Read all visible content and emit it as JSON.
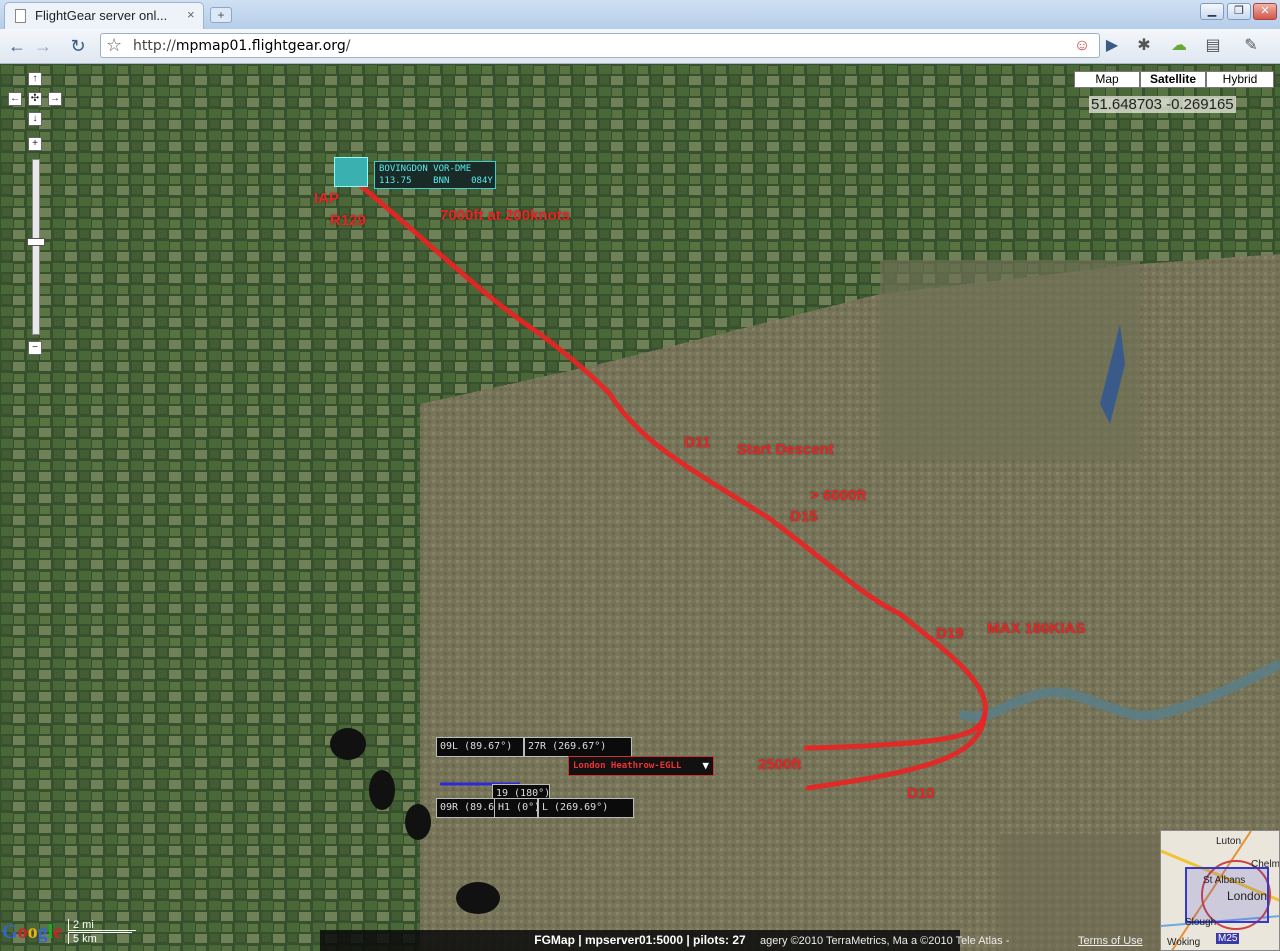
{
  "browser": {
    "tab_title": "FlightGear server onl...",
    "tab_close": "×",
    "new_tab": "+",
    "window_controls": {
      "minimize": "▁",
      "restore": "❐",
      "close": "✕"
    },
    "nav": {
      "back": "←",
      "forward": "→",
      "reload": "↻"
    },
    "url_prefix": "http://",
    "url_host": "mpmap01.flightgear.org",
    "url_path": "/"
  },
  "map": {
    "type_buttons": [
      "Map",
      "Satellite",
      "Hybrid"
    ],
    "selected_type": "Satellite",
    "coordinates": "51.648703 -0.269165",
    "controls": {
      "up": "↑",
      "down": "↓",
      "left": "←",
      "right": "→",
      "center": "✣",
      "zoom_in": "+",
      "zoom_out": "−"
    },
    "navaid": {
      "name_line": "BOVINGDON VOR-DME",
      "freq_line": "113.75    BNN    084Y"
    },
    "annotations": {
      "iap": "IAP",
      "r129": "R129",
      "alt_speed": "7000ft at 200knots",
      "d11": "D11",
      "start_descent": "Start Descent",
      "gt6000": ">  6000ft",
      "d15": "D15",
      "d19": "D19",
      "max180": "MAX 180KIAS",
      "alt2500": "2500ft",
      "d10": "D10"
    },
    "runways": {
      "r09l": "09L (89.67°)",
      "r27r": "27R (269.67°)",
      "r09r": "09R (89.6",
      "r27l": "L (269.69°)",
      "r19": "19 (180°)",
      "h1": "H1 (0°)"
    },
    "airport": "London Heathrow-EGLL",
    "airport_dropdown": "▼",
    "status": "FGMap | mpserver01:5000 | pilots: 27",
    "copyright": "agery ©2010 TerraMetrics, Ma   a ©2010 Tele Atlas -",
    "terms": "Terms of Use",
    "scale": {
      "miles": "2 mi",
      "km": "5 km"
    },
    "google": [
      "G",
      "o",
      "o",
      "g",
      "l",
      "e"
    ],
    "overview": {
      "labels": [
        "Luton",
        "Chelms",
        "St Albans",
        "London",
        "Slough",
        "Woking",
        "M25"
      ]
    },
    "colors": {
      "route": "#e82424",
      "navaid": "#55eeee",
      "urban": "#7f7a5e",
      "countryside": "#3f5a33"
    }
  }
}
